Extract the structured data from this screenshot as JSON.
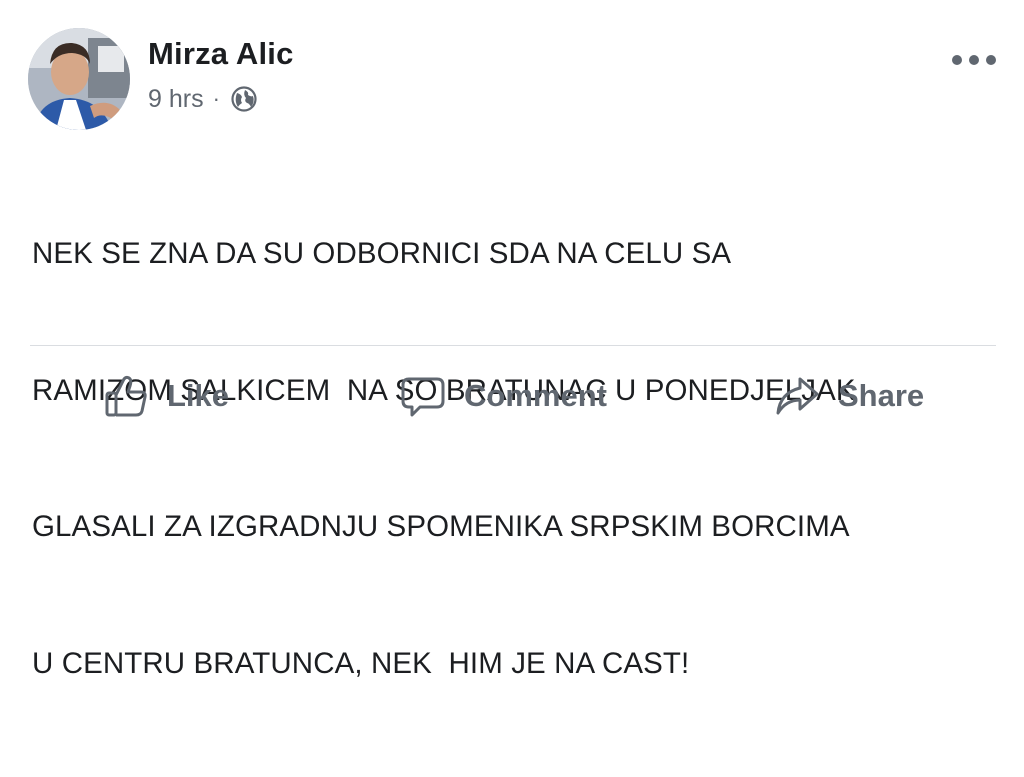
{
  "post": {
    "author": "Mirza Alic",
    "time": "9 hrs",
    "separator": "·",
    "privacy_icon": "globe-icon",
    "more_icon": "more-options-icon",
    "text_lines": [
      "NEK SE ZNA DA SU ODBORNICI SDA NA CELU SA",
      "RAMIZOM SALKICEM  NA SO BRATUNAC U PONEDJELJAK",
      "GLASALI ZA IZGRADNJU SPOMENIKA SRPSKIM BORCIMA",
      "U CENTRU BRATUNCA, NEK  HIM JE NA CAST!"
    ]
  },
  "actions": {
    "like": {
      "label": "Like",
      "icon": "thumbs-up-icon"
    },
    "comment": {
      "label": "Comment",
      "icon": "comment-bubble-icon"
    },
    "share": {
      "label": "Share",
      "icon": "share-arrow-icon"
    }
  },
  "colors": {
    "text_primary": "#1c1e21",
    "text_secondary": "#606770",
    "divider": "#dadde1"
  }
}
